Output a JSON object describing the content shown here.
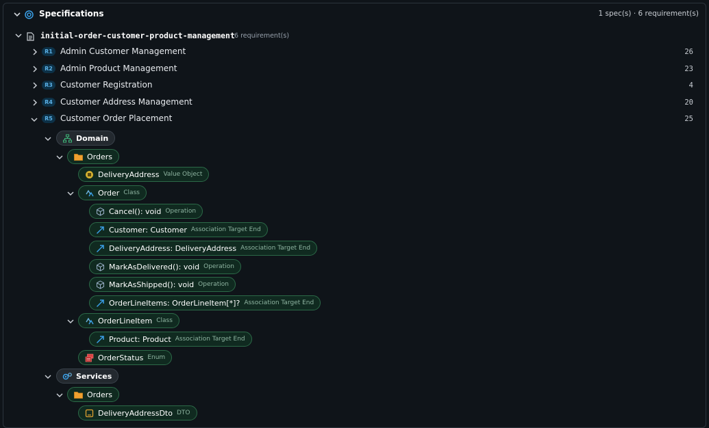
{
  "header": {
    "title": "Specifications",
    "summary": "1 spec(s) · 6 requirement(s)"
  },
  "spec": {
    "name": "initial-order-customer-product-management",
    "count": "6 requirement(s)"
  },
  "requirements": [
    {
      "badge": "R1",
      "label": "Admin Customer Management",
      "count": "26"
    },
    {
      "badge": "R2",
      "label": "Admin Product Management",
      "count": "23"
    },
    {
      "badge": "R3",
      "label": "Customer Registration",
      "count": "4"
    },
    {
      "badge": "R4",
      "label": "Customer Address Management",
      "count": "20"
    },
    {
      "badge": "R5",
      "label": "Customer Order Placement",
      "count": "25"
    }
  ],
  "tree": {
    "domain": "Domain",
    "orders_folder": "Orders",
    "delivery_address": {
      "name": "DeliveryAddress",
      "kind": "Value Object"
    },
    "order": {
      "name": "Order",
      "kind": "Class"
    },
    "order_members": [
      {
        "name": "Cancel(): void",
        "kind": "Operation",
        "icon": "cube-icon"
      },
      {
        "name": "Customer: Customer",
        "kind": "Association Target End",
        "icon": "arrow-icon"
      },
      {
        "name": "DeliveryAddress: DeliveryAddress",
        "kind": "Association Target End",
        "icon": "arrow-icon"
      },
      {
        "name": "MarkAsDelivered(): void",
        "kind": "Operation",
        "icon": "cube-icon"
      },
      {
        "name": "MarkAsShipped(): void",
        "kind": "Operation",
        "icon": "cube-icon"
      },
      {
        "name": "OrderLineItems: OrderLineItem[*]?",
        "kind": "Association Target End",
        "icon": "arrow-icon"
      }
    ],
    "order_line_item": {
      "name": "OrderLineItem",
      "kind": "Class"
    },
    "product": {
      "name": "Product: Product",
      "kind": "Association Target End"
    },
    "order_status": {
      "name": "OrderStatus",
      "kind": "Enum"
    },
    "services": "Services",
    "services_orders_folder": "Orders",
    "delivery_address_dto": {
      "name": "DeliveryAddressDto",
      "kind": "DTO"
    }
  },
  "colors": {
    "accent_blue": "#3aa0e8",
    "pill_green_border": "#2c6a48",
    "badge_bg": "#0d3147"
  }
}
